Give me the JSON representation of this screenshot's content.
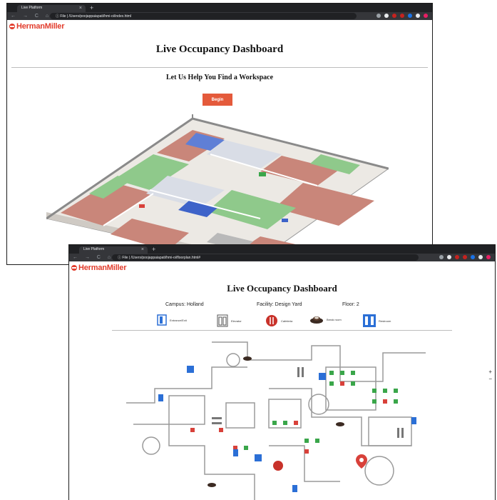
{
  "window1": {
    "tab_title": "Live Platform",
    "tab_close": "×",
    "new_tab": "+",
    "nav_icons": "← → C ⌂",
    "url": "ⓘ File | /Users/poojappaiapati/hmi-oi/index.html",
    "logo": "HermanMiller",
    "title": "Live Occupancy Dashboard",
    "subtitle": "Let Us Help You Find a Workspace",
    "begin_label": "Begin"
  },
  "window2": {
    "tab_title": "Live Platform",
    "tab_close": "×",
    "new_tab": "+",
    "nav_icons": "← → C ⌂",
    "url": "ⓘ File | /Users/poojappaiapati/hmi-oi/floorplan.html#",
    "logo": "HermanMiller",
    "title": "Live Occupancy Dashboard",
    "campus": "Campus: Holland",
    "facility": "Facility: Design Yard",
    "floor": "Floor: 2",
    "legend": [
      {
        "icon": "entrance-exit-icon",
        "label": "Entrance/Exit"
      },
      {
        "icon": "elevator-icon",
        "label": "Elevator"
      },
      {
        "icon": "cafeteria-icon",
        "label": "Cafeteria"
      },
      {
        "icon": "break-room-icon",
        "label": "Break room"
      },
      {
        "icon": "restroom-icon",
        "label": "Restroom"
      }
    ],
    "zoom_in": "+",
    "zoom_out": "−"
  },
  "colors": {
    "brand_red": "#e23c2c",
    "begin_button": "#e45a3b",
    "chrome_dark": "#202124",
    "chrome_tab": "#35363a",
    "restroom_blue": "#2b6fd6",
    "desk_green": "#3aa64a",
    "desk_red": "#d8413a"
  }
}
